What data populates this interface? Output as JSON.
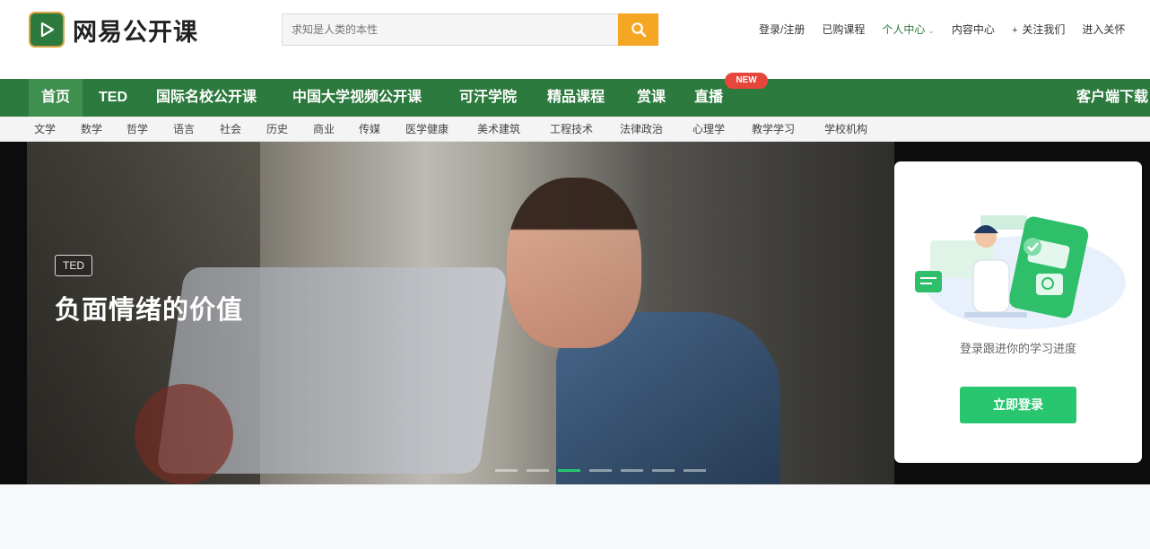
{
  "brand": {
    "name": "网易公开课"
  },
  "search": {
    "placeholder": "求知是人类的本性"
  },
  "toplinks": {
    "login_register": "登录/注册",
    "purchased": "已购课程",
    "personal_center": "个人中心",
    "content_center": "内容中心",
    "follow_us": "关注我们",
    "enter_partial": "进入关怀"
  },
  "mainnav": {
    "items": [
      {
        "label": "首页"
      },
      {
        "label": "TED"
      },
      {
        "label": "国际名校公开课"
      },
      {
        "label": "中国大学视频公开课"
      },
      {
        "label": "可汗学院"
      },
      {
        "label": "精品课程"
      },
      {
        "label": "赏课"
      },
      {
        "label": "直播"
      }
    ],
    "new_badge": "NEW",
    "client_download": "客户端下载"
  },
  "categories": [
    "文学",
    "数学",
    "哲学",
    "语言",
    "社会",
    "历史",
    "商业",
    "传媒",
    "医学健康",
    "美术建筑",
    "工程技术",
    "法律政治",
    "心理学",
    "教学学习",
    "学校机构"
  ],
  "banner": {
    "tag": "TED",
    "title": "负面情绪的价值",
    "carousel_active_index": 2,
    "carousel_count": 7
  },
  "login_card": {
    "text": "登录跟进你的学习进度",
    "button": "立即登录"
  },
  "colors": {
    "brand_green": "#2c7a3d",
    "accent_orange": "#f5a623",
    "button_green": "#28c76f",
    "badge_red": "#e8453c"
  }
}
